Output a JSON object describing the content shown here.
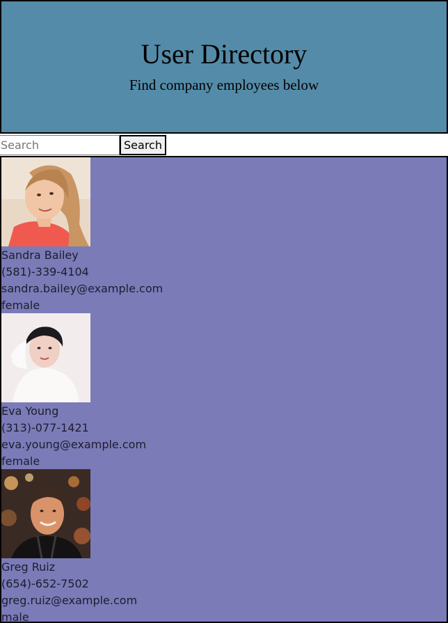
{
  "header": {
    "title": "User Directory",
    "subtitle": "Find company employees below"
  },
  "search": {
    "placeholder": "Search",
    "button_label": "Search"
  },
  "colors": {
    "header_bg": "#548ba8",
    "results_bg": "#7b7bb8"
  },
  "users": [
    {
      "name": "Sandra Bailey",
      "phone": "(581)-339-4104",
      "email": "sandra.bailey@example.com",
      "gender": "female",
      "photo": "avatar-photo-woman-blonde"
    },
    {
      "name": "Eva Young",
      "phone": "(313)-077-1421",
      "email": "eva.young@example.com",
      "gender": "female",
      "photo": "avatar-photo-woman-dark-hair"
    },
    {
      "name": "Greg Ruiz",
      "phone": "(654)-652-7502",
      "email": "greg.ruiz@example.com",
      "gender": "male",
      "photo": "avatar-photo-man-night-city"
    }
  ]
}
